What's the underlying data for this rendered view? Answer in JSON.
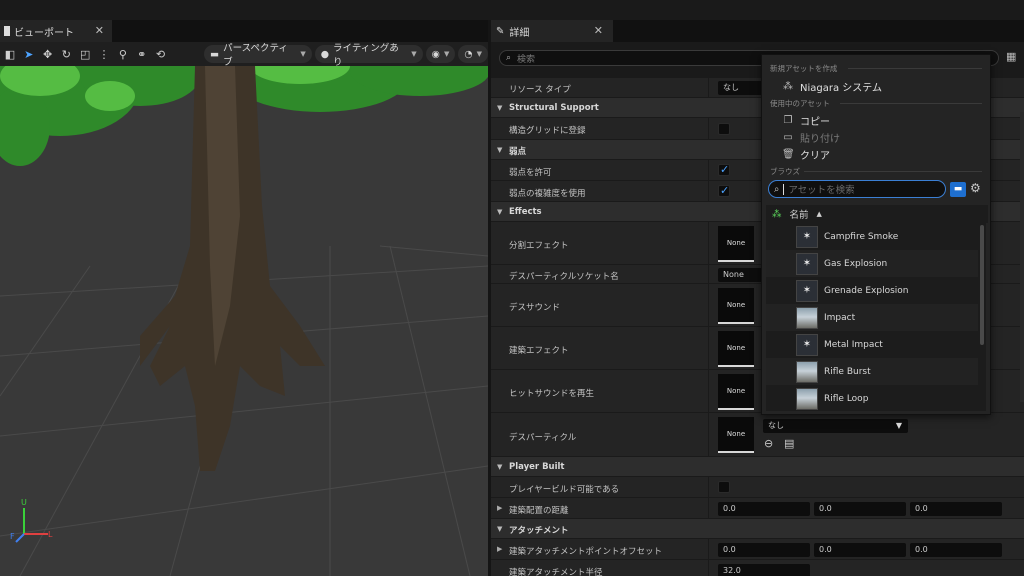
{
  "viewport": {
    "tab_label": "ビューポート",
    "perspective_label": "パースペクティブ",
    "lighting_label": "ライティングあり",
    "axis": {
      "u": "U",
      "f": "F",
      "l": "L"
    }
  },
  "details": {
    "tab_label": "詳細",
    "search_placeholder": "検索",
    "rows": {
      "resource_type": {
        "name": "リソース タイプ",
        "value": "なし"
      },
      "cat_structural": "Structural Support",
      "register_grid": "構造グリッドに登録",
      "cat_weakpoint": "弱点",
      "allow_weakpoint": "弱点を許可",
      "use_weak_complexity": "弱点の複雑度を使用",
      "cat_effects": "Effects",
      "split_effect": "分割エフェクト",
      "death_particle_socket": {
        "name": "デスパーティクルソケット名",
        "value": "None"
      },
      "death_sound": "デスサウンド",
      "build_effect": "建築エフェクト",
      "play_hit_sound": "ヒットサウンドを再生",
      "death_particle": "デスパーティクル",
      "cat_player_built": "Player Built",
      "player_buildable": "プレイヤービルド可能である",
      "build_distance": "建築配置の距離",
      "cat_attachment": "アタッチメント",
      "attach_offset": "建築アタッチメントポイントオフセット",
      "attach_radius": {
        "name": "建築アタッチメント半径",
        "value": "32.0"
      }
    },
    "none_thumb": "None",
    "vec_zero": "0.0",
    "dropdown_none": "なし"
  },
  "picker": {
    "hdr_create": "新規アセットを作成",
    "niagara_system": "Niagara システム",
    "hdr_current": "使用中のアセット",
    "copy": "コピー",
    "paste": "貼り付け",
    "clear": "クリア",
    "hdr_browse": "ブラウズ",
    "search_placeholder": "アセットを検索",
    "col_name": "名前",
    "assets": [
      {
        "name": "Campfire Smoke",
        "kind": "fx"
      },
      {
        "name": "Gas Explosion",
        "kind": "fx"
      },
      {
        "name": "Grenade Explosion",
        "kind": "fx"
      },
      {
        "name": "Impact",
        "kind": "img"
      },
      {
        "name": "Metal Impact",
        "kind": "fx"
      },
      {
        "name": "Rifle Burst",
        "kind": "img"
      },
      {
        "name": "Rifle Loop",
        "kind": "img"
      }
    ]
  },
  "colors": {
    "accent": "#4da3ff",
    "focus": "#3b7fd4",
    "folder": "#1e6fd0"
  }
}
